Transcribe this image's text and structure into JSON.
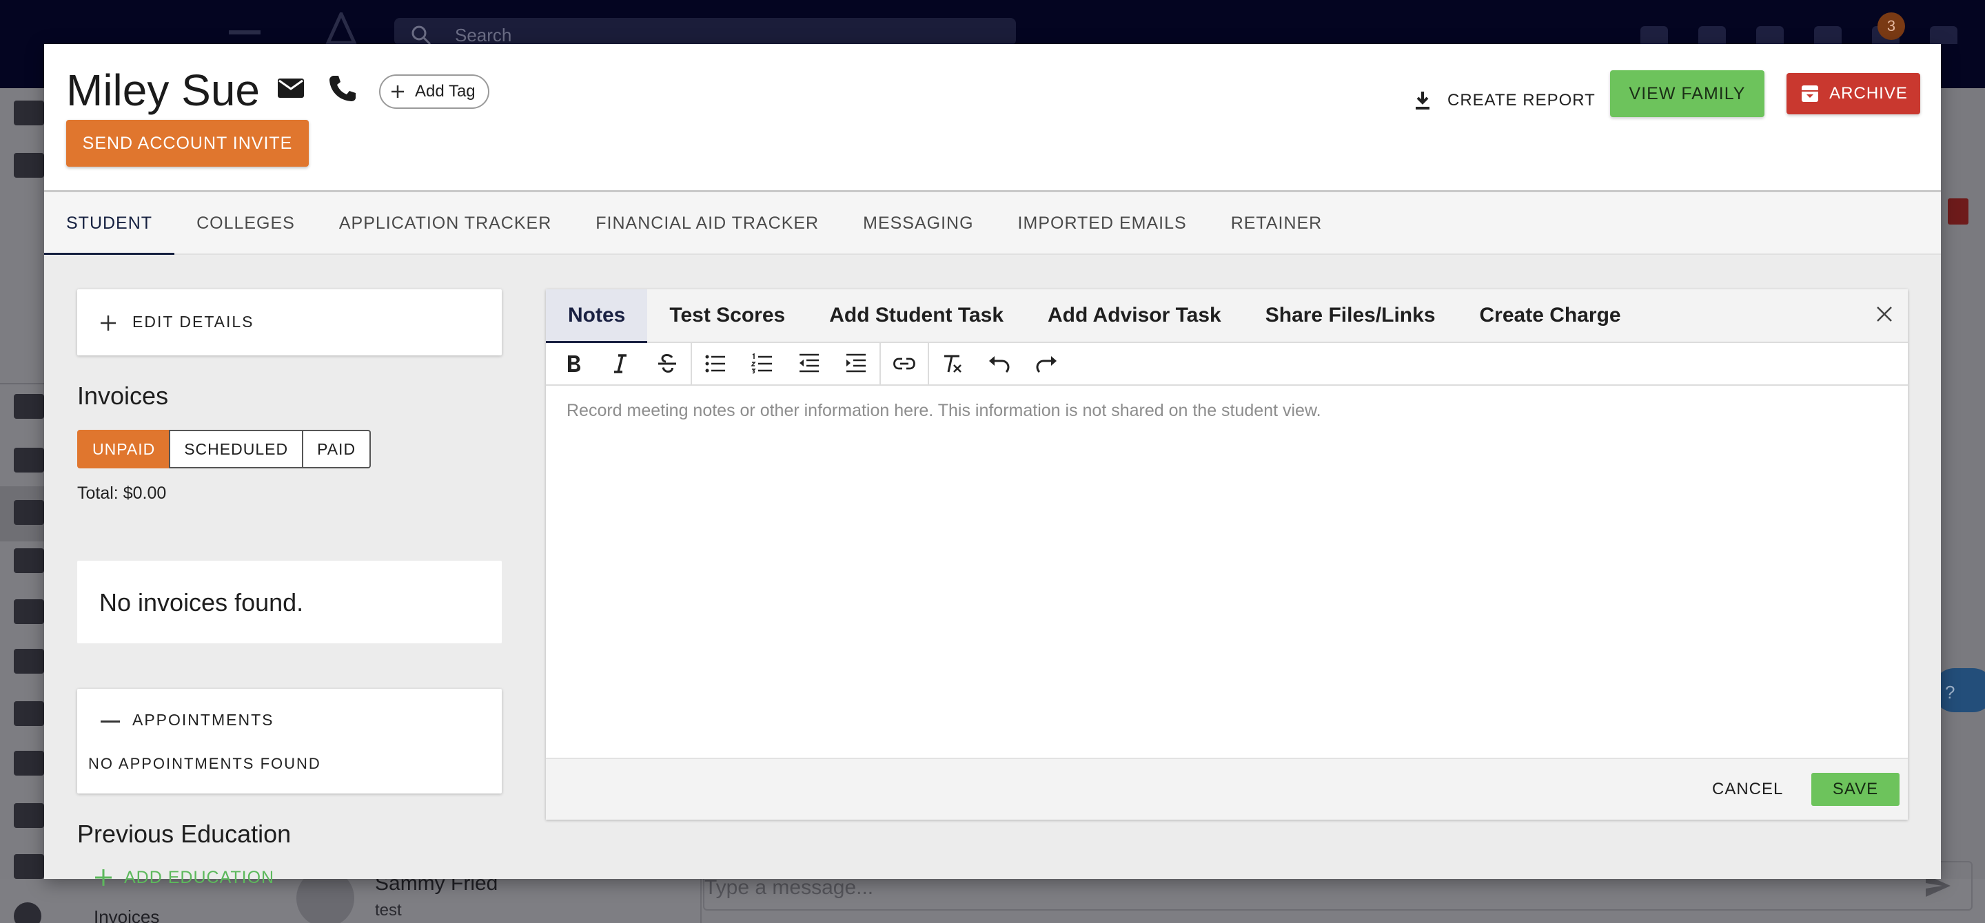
{
  "background": {
    "search_placeholder": "Search",
    "notification_count": "3",
    "contact_name": "Sammy Fried",
    "contact_subtitle": "test",
    "message_placeholder": "Type a message...",
    "sidebar_invoices_label": "Invoices",
    "help_text": "?"
  },
  "header": {
    "student_name": "Miley Sue",
    "add_tag_label": "Add Tag",
    "send_invite_label": "SEND ACCOUNT INVITE",
    "create_report_label": "CREATE REPORT",
    "view_family_label": "VIEW FAMILY",
    "archive_label": "ARCHIVE",
    "colors": {
      "orange": "#e0762e",
      "green": "#6dc35c",
      "red": "#c9382f",
      "navy": "#152040"
    }
  },
  "tabs": [
    {
      "label": "STUDENT",
      "active": true
    },
    {
      "label": "COLLEGES"
    },
    {
      "label": "APPLICATION TRACKER"
    },
    {
      "label": "FINANCIAL AID TRACKER"
    },
    {
      "label": "MESSAGING"
    },
    {
      "label": "IMPORTED EMAILS"
    },
    {
      "label": "RETAINER"
    }
  ],
  "left": {
    "edit_details_label": "EDIT DETAILS",
    "invoices_title": "Invoices",
    "invoice_filters": [
      "UNPAID",
      "SCHEDULED",
      "PAID"
    ],
    "invoice_filter_selected": "UNPAID",
    "total_label": "Total: $0.00",
    "no_invoices_label": "No invoices found.",
    "appointments_label": "APPOINTMENTS",
    "no_appointments_label": "NO APPOINTMENTS FOUND",
    "previous_education_title": "Previous Education",
    "add_education_label": "ADD EDUCATION"
  },
  "editor": {
    "tabs": [
      "Notes",
      "Test Scores",
      "Add Student Task",
      "Add Advisor Task",
      "Share Files/Links",
      "Create Charge"
    ],
    "active_tab": "Notes",
    "toolbar": [
      "bold-icon",
      "italic-icon",
      "strikethrough-icon",
      "bullet-list-icon",
      "numbered-list-icon",
      "outdent-icon",
      "indent-icon",
      "link-icon",
      "clear-format-icon",
      "undo-icon",
      "redo-icon"
    ],
    "placeholder": "Record meeting notes or other information here. This information is not shared on the student view.",
    "cancel_label": "CANCEL",
    "save_label": "SAVE"
  }
}
